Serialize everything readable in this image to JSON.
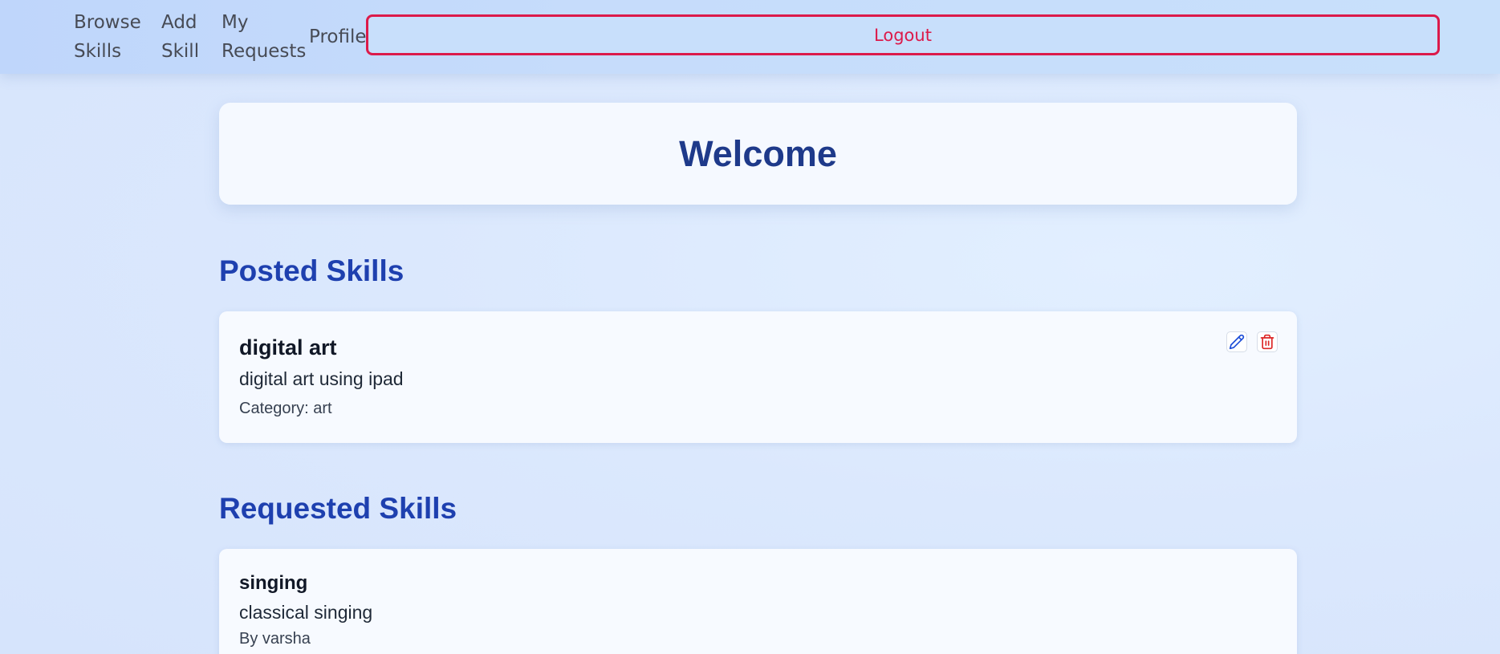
{
  "nav": {
    "browse_skills": "Browse Skills",
    "add_skill": "Add Skill",
    "my_requests": "My Requests",
    "profile": "Profile",
    "logout": "Logout"
  },
  "welcome": {
    "title": "Welcome"
  },
  "posted": {
    "heading": "Posted Skills",
    "skills": [
      {
        "title": "digital art",
        "description": "digital art using ipad",
        "category": "Category: art",
        "actions": {
          "edit_icon": "pencil-icon",
          "delete_icon": "trash-icon"
        }
      }
    ]
  },
  "requested": {
    "heading": "Requested Skills",
    "skills": [
      {
        "title": "singing",
        "description": "classical singing",
        "author": "By varsha"
      }
    ]
  },
  "colors": {
    "heading_blue": "#1e40af",
    "welcome_blue": "#1e3a8a",
    "logout_red": "#dc1a4a",
    "edit_blue": "#1d4ed8",
    "delete_red": "#dc2626",
    "navbar_bg": "#c6dcfb"
  }
}
